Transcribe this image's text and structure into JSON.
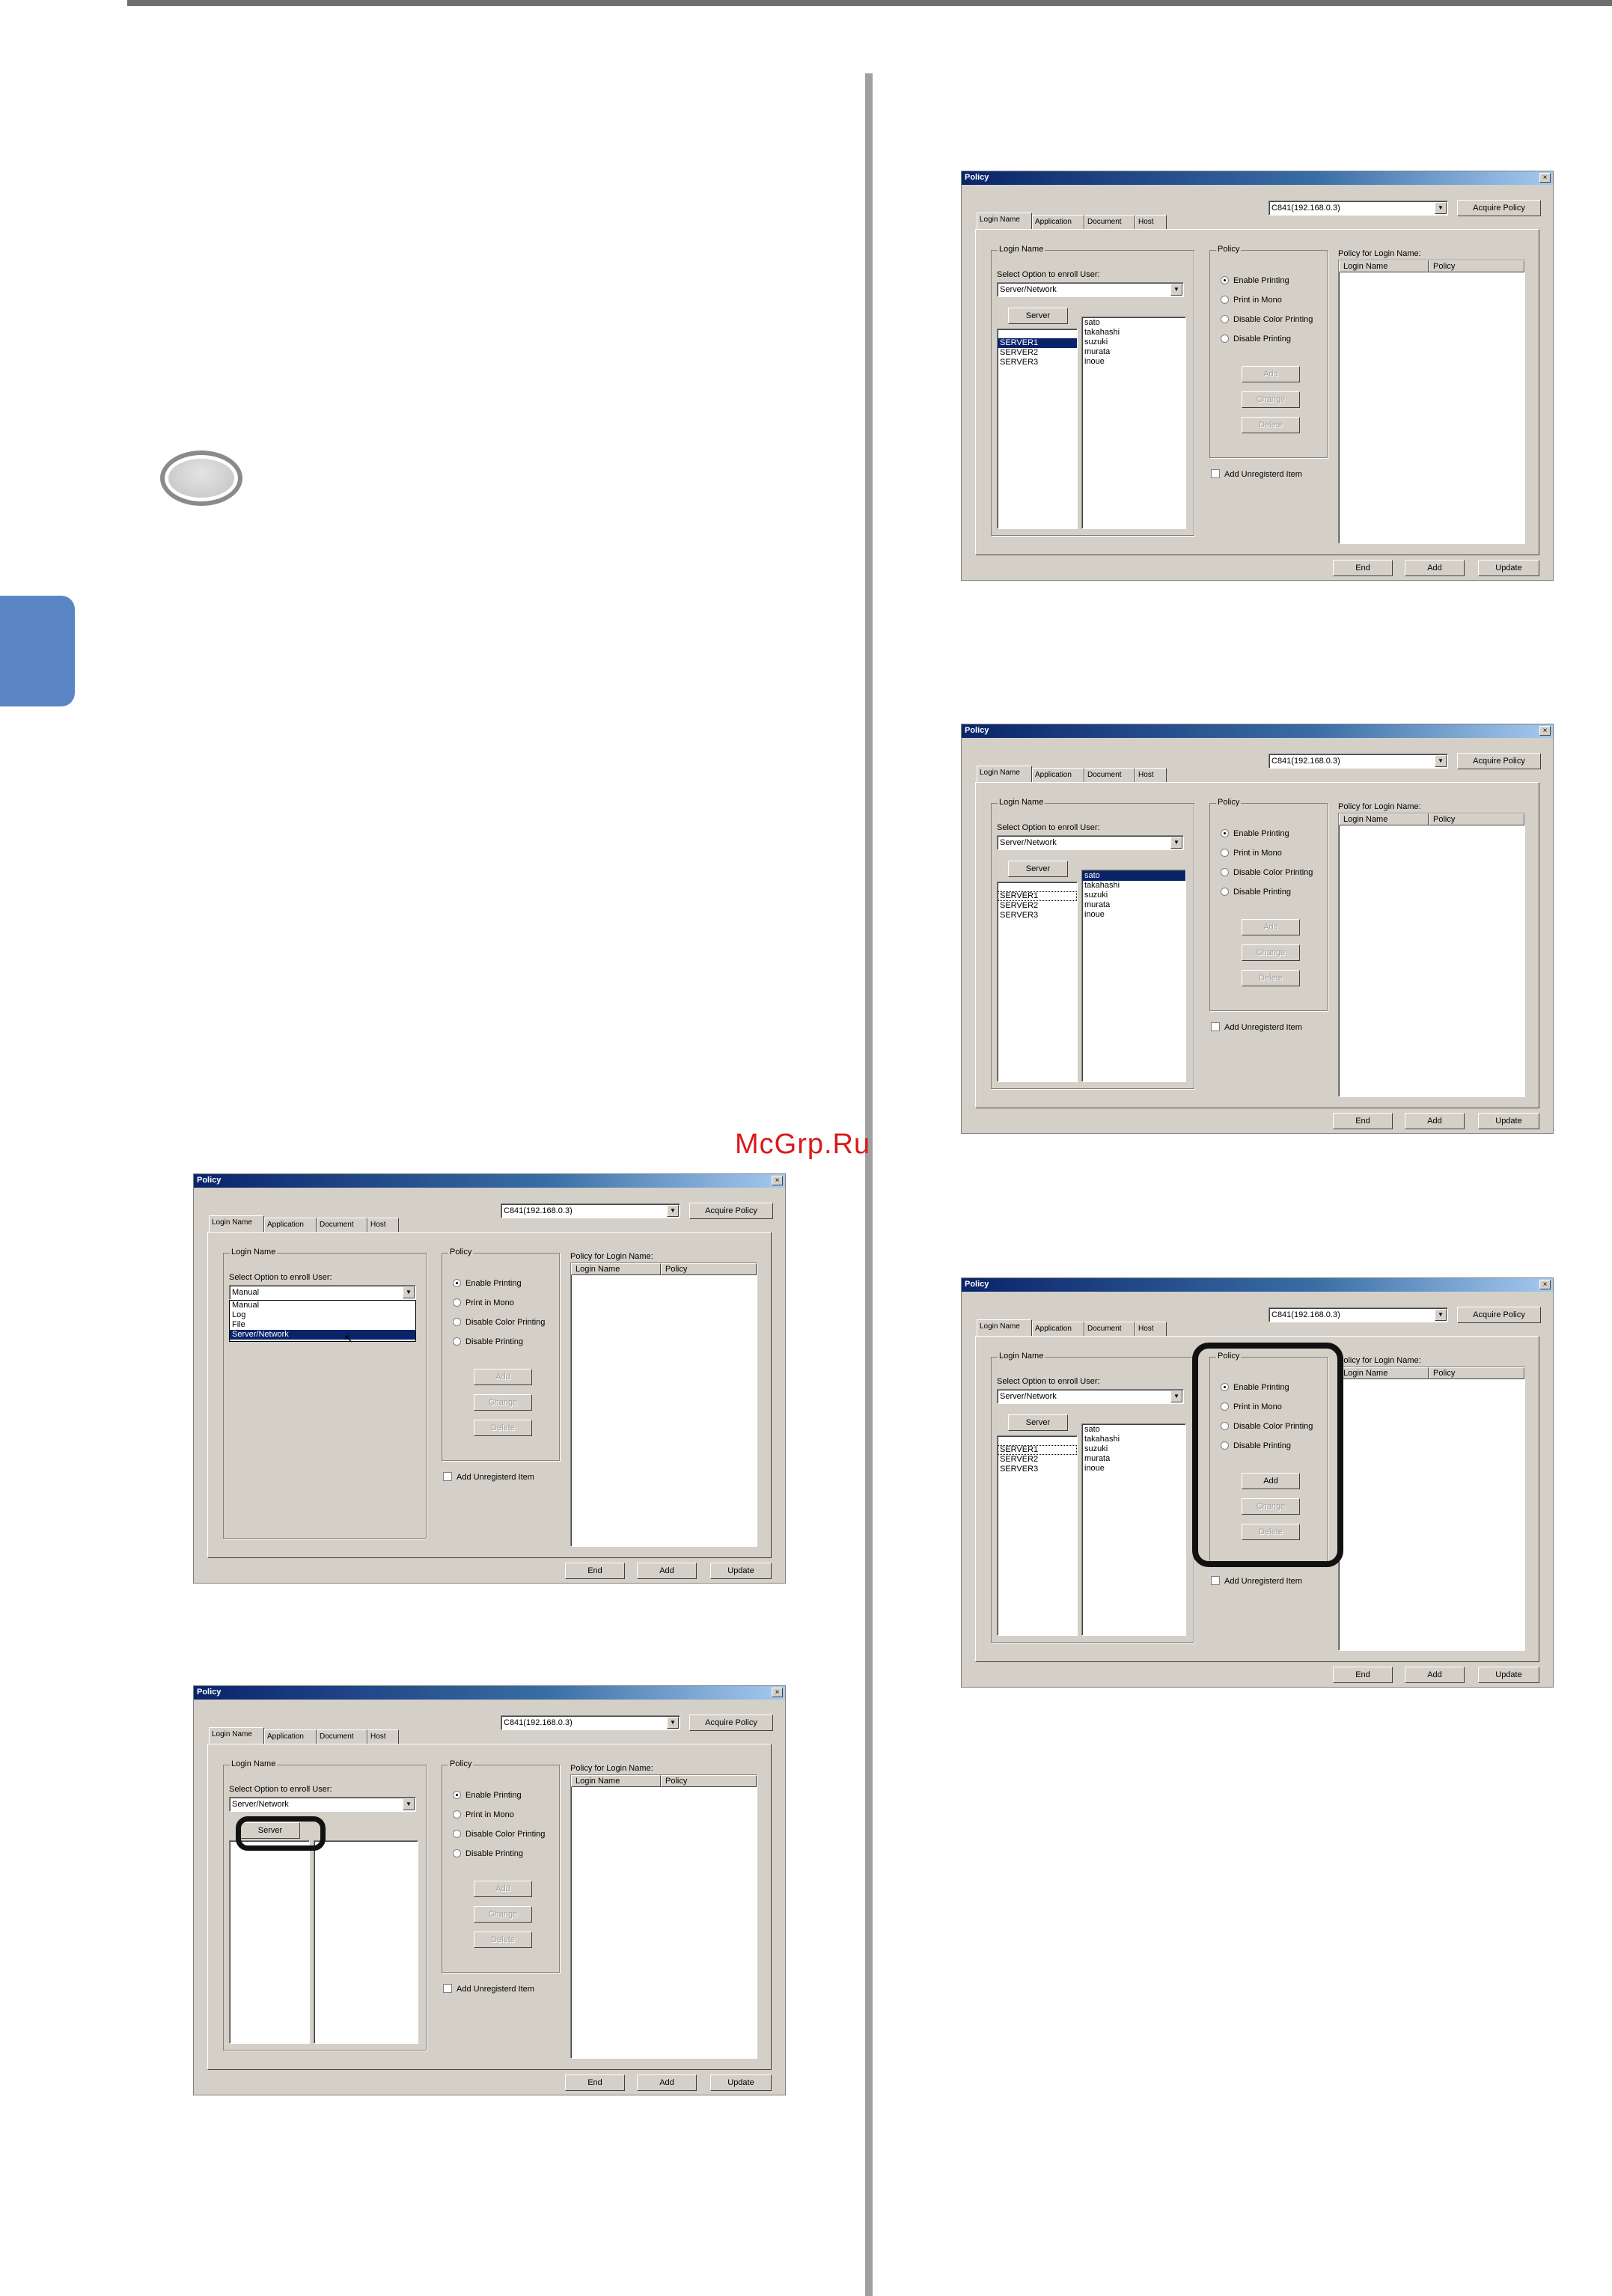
{
  "watermark": "McGrp.Ru",
  "dialog": {
    "title": "Policy",
    "close": "×",
    "printer": "C841(192.168.0.3)",
    "acquire": "Acquire Policy",
    "tabs": [
      "Login Name",
      "Application",
      "Document",
      "Host"
    ],
    "login_group": "Login Name",
    "select_option_label": "Select Option to enroll User:",
    "option_manual": "Manual",
    "option_server": "Server/Network",
    "dropdown_options": [
      "Manual",
      "Log",
      "File",
      "Server/Network"
    ],
    "server_button": "Server",
    "servers": [
      "SERVER1",
      "SERVER2",
      "SERVER3"
    ],
    "users": [
      "sato",
      "takahashi",
      "suzuki",
      "murata",
      "inoue"
    ],
    "policy_group": "Policy",
    "radios": [
      "Enable Printing",
      "Print in Mono",
      "Disable Color Printing",
      "Disable Printing"
    ],
    "add": "Add",
    "change": "Change",
    "delete": "Delete",
    "add_unregistered": "Add Unregisterd Item",
    "policy_for_label": "Policy for Login Name:",
    "col_login": "Login Name",
    "col_policy": "Policy",
    "end": "End",
    "update": "Update"
  }
}
